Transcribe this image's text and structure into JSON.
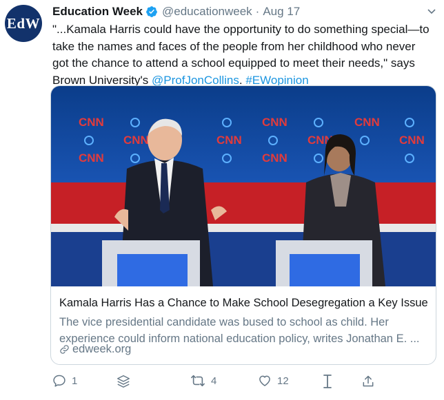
{
  "tweet": {
    "avatar_text": "EdW",
    "author_name": "Education Week",
    "handle": "@educationweek",
    "separator": "·",
    "date": "Aug 17",
    "text_main": "\"...Kamala Harris could have the opportunity to do something special—to take the names and faces of the people from her childhood who never got the chance to attend a school equipped to meet their needs,\" says Brown University's",
    "mention": "@ProfJonCollins",
    "hashtag": "#EWopinion"
  },
  "card": {
    "title": "Kamala Harris Has a Chance to Make School Desegregation a Key Issue",
    "description_line1": "The vice presidential candidate was bused to school as child. Her",
    "description_line2": "experience could inform national education policy, writes Jonathan E. ...",
    "domain": "edweek.org",
    "image_logo_text": "CNN"
  },
  "actions": {
    "reply_count": "1",
    "retweet_count": "4",
    "like_count": "12"
  },
  "icons": {
    "verified": "verified-badge-icon",
    "more": "chevron-down-icon",
    "reply": "reply-icon",
    "thread": "thread-stack-icon",
    "retweet": "retweet-icon",
    "like": "heart-icon",
    "reader": "text-cursor-icon",
    "share": "share-icon",
    "link": "link-icon"
  },
  "colors": {
    "brand_blue": "#1da1f2",
    "link_blue": "#1b95e0",
    "text_primary": "#14171a",
    "text_secondary": "#657786",
    "avatar_bg": "#12326b",
    "card_border": "#ccd6dd"
  }
}
